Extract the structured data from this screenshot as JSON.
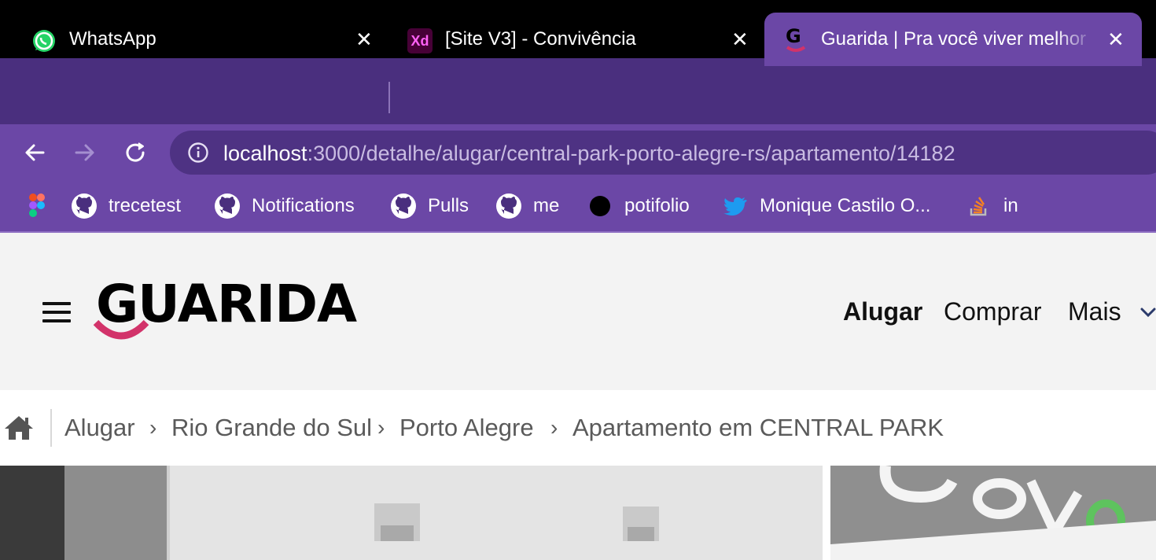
{
  "browser": {
    "tabs": [
      {
        "title": "WhatsApp",
        "icon": "whatsapp-icon"
      },
      {
        "title": "[Site V3] - Convivência",
        "icon": "adobe-xd-icon",
        "icon_text": "Xd"
      },
      {
        "title": "Guarida | Pra você viver melhor",
        "icon": "guarida-g-icon",
        "active": true
      }
    ],
    "url_host": "localhost",
    "url_rest": ":3000/detalhe/alugar/central-park-porto-alegre-rs/apartamento/14182",
    "bookmarks": [
      {
        "label": "",
        "icon": "figma-icon"
      },
      {
        "label": "trecetest",
        "icon": "github-icon"
      },
      {
        "label": "Notifications",
        "icon": "github-icon"
      },
      {
        "label": "Pulls",
        "icon": "github-icon"
      },
      {
        "label": "me",
        "icon": "github-icon"
      },
      {
        "label": "potifolio",
        "icon": "black-circle-icon"
      },
      {
        "label": "Monique Castilo O...",
        "icon": "twitter-icon"
      },
      {
        "label": "in",
        "icon": "stackoverflow-icon"
      }
    ],
    "colors": {
      "tabstrip": "#4a2f7e",
      "toolbar": "#6b47a6",
      "omnibox": "#4e3283"
    }
  },
  "site": {
    "logo": "GUARIDA",
    "nav": {
      "alugar": "Alugar",
      "comprar": "Comprar",
      "mais": "Mais"
    },
    "breadcrumb": [
      "Alugar",
      "Rio Grande do Sul",
      "Porto Alegre",
      "Apartamento em CENTRAL PARK"
    ],
    "breadcrumb_separator": "›",
    "colors": {
      "brand_pink": "#d2336a",
      "header_bg": "#f3f3f3"
    }
  }
}
